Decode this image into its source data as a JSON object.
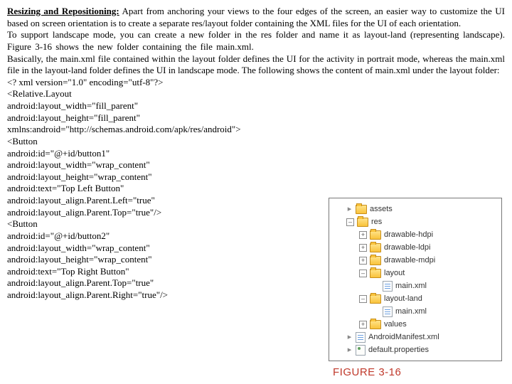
{
  "heading": "Resizing and Repositioning:",
  "para1_rest": " Apart from anchoring your views to the four edges of the screen, an easier way to customize the UI based on screen orientation is to create a separate res/layout folder containing the XML files for the UI of each orientation.",
  "para2": "To support landscape mode, you can create a new folder in the res folder and name it as layout-land (representing landscape). Figure 3-16 shows the new folder containing the file main.xml.",
  "para3": "Basically, the main.xml file contained within the layout folder defines the UI for the activity in portrait mode, whereas the main.xml file in the layout-land folder defines the UI in landscape mode. The following shows the content of main.xml under the layout folder:",
  "code": [
    "<? xml version=\"1.0\" encoding=\"utf-8\"?>",
    "<Relative.Layout",
    "android:layout_width=\"fill_parent\"",
    "android:layout_height=\"fill_parent\"",
    "xmlns:android=\"http://schemas.android.com/apk/res/android\">",
    "<Button",
    "android:id=\"@+id/button1\"",
    "android:layout_width=\"wrap_content\"",
    "android:layout_height=\"wrap_content\"",
    "android:text=\"Top Left Button\"",
    "android:layout_align.Parent.Left=\"true\"",
    "android:layout_align.Parent.Top=\"true\"/>",
    "<Button",
    "android:id=\"@+id/button2\"",
    "android:layout_width=\"wrap_content\"",
    "android:layout_height=\"wrap_content\"",
    "android:text=\"Top Right Button\"",
    "android:layout_align.Parent.Top=\"true\"",
    "android:layout_align.Parent.Right=\"true\"/>"
  ],
  "tree": {
    "assets": "assets",
    "res": "res",
    "drawable_hdpi": "drawable-hdpi",
    "drawable_ldpi": "drawable-ldpi",
    "drawable_mdpi": "drawable-mdpi",
    "layout": "layout",
    "main1": "main.xml",
    "layout_land": "layout-land",
    "main2": "main.xml",
    "values": "values",
    "manifest": "AndroidManifest.xml",
    "props": "default.properties"
  },
  "figure_caption": "FIGURE 3-16"
}
